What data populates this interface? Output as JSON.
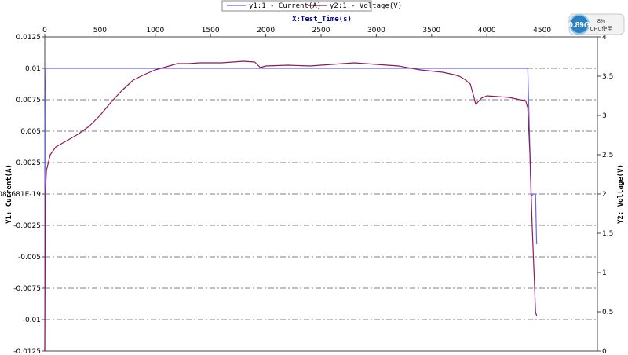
{
  "chart_data": {
    "type": "line",
    "x_axis": {
      "title": "X:Test_Time(s)",
      "range": [
        0,
        5000
      ],
      "ticks": [
        0,
        500,
        1000,
        1500,
        2000,
        2500,
        3000,
        3500,
        4000,
        4500
      ],
      "tick_labels": [
        "0",
        "500",
        "1000",
        "1500",
        "2000",
        "2500",
        "3000",
        "3500",
        "4000",
        "4500"
      ],
      "position": "top"
    },
    "y1_axis": {
      "title": "Y1: Current(A)",
      "range": [
        -0.0125,
        0.0125
      ],
      "ticks": [
        0.0125,
        0.01,
        0.0075,
        0.005,
        0.0025,
        0,
        -0.0025,
        -0.005,
        -0.0075,
        -0.01,
        -0.0125
      ],
      "tick_labels": [
        "0.0125",
        "0.01",
        "0.0075",
        "0.005",
        "0.0025",
        "1.083681E-19",
        "-0.0025",
        "-0.005",
        "-0.0075",
        "-0.01",
        "-0.0125"
      ]
    },
    "y2_axis": {
      "title": "Y2: Voltage(V)",
      "range": [
        0,
        4
      ],
      "ticks": [
        4,
        3.5,
        3,
        2.5,
        2,
        1.5,
        1,
        0.5,
        0
      ],
      "tick_labels": [
        "4",
        "3.5",
        "3",
        "2.5",
        "2",
        "1.5",
        "1",
        "0.5",
        "0"
      ]
    },
    "grid": true,
    "legend_placement": "top-center",
    "series": [
      {
        "name": "y1:1 - Current(A)",
        "axis": "y1",
        "color": "#6666ee",
        "x": [
          0,
          3,
          10,
          4370,
          4385,
          4400,
          4420,
          4440,
          4450
        ],
        "y": [
          -0.0125,
          0.006,
          0.01,
          0.01,
          0.005,
          -0.0002,
          0,
          0,
          -0.004
        ]
      },
      {
        "name": "y2:1 - Voltage(V)",
        "axis": "y2",
        "color": "#8b1a5a",
        "x": [
          0,
          5,
          15,
          50,
          100,
          200,
          300,
          400,
          500,
          600,
          700,
          800,
          900,
          1000,
          1100,
          1200,
          1300,
          1400,
          1500,
          1600,
          1700,
          1800,
          1900,
          1950,
          2000,
          2200,
          2400,
          2600,
          2800,
          3000,
          3200,
          3400,
          3600,
          3700,
          3750,
          3800,
          3850,
          3880,
          3900,
          3950,
          4000,
          4100,
          4200,
          4300,
          4350,
          4370,
          4390,
          4410,
          4430,
          4440,
          4450
        ],
        "y": [
          0,
          2.0,
          2.3,
          2.5,
          2.6,
          2.68,
          2.76,
          2.86,
          3.0,
          3.17,
          3.32,
          3.45,
          3.52,
          3.58,
          3.62,
          3.66,
          3.66,
          3.67,
          3.67,
          3.67,
          3.68,
          3.69,
          3.68,
          3.61,
          3.63,
          3.64,
          3.63,
          3.65,
          3.67,
          3.65,
          3.63,
          3.58,
          3.55,
          3.52,
          3.5,
          3.46,
          3.4,
          3.25,
          3.14,
          3.22,
          3.25,
          3.24,
          3.23,
          3.2,
          3.19,
          3.1,
          2.5,
          1.6,
          0.9,
          0.5,
          0.45
        ]
      }
    ]
  },
  "widget": {
    "main": "0.89G",
    "percent": "8%",
    "label": "CPU使用"
  }
}
